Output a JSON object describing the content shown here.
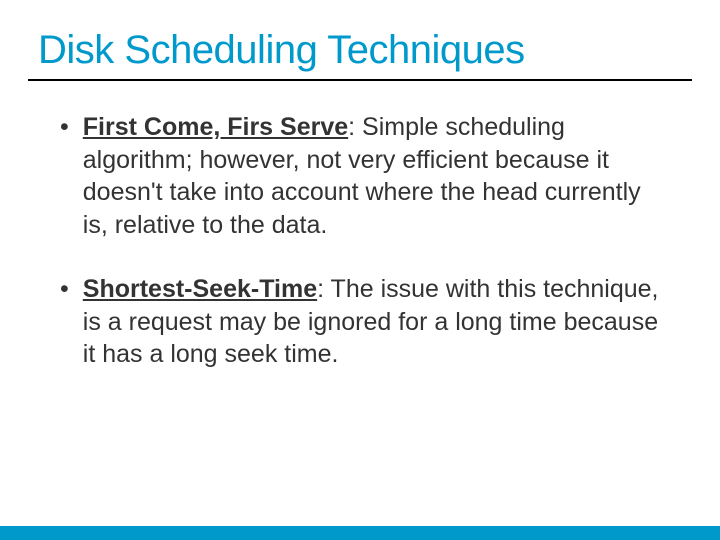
{
  "title": "Disk Scheduling Techniques",
  "bullets": [
    {
      "term": "First Come, Firs Serve",
      "definition": ": Simple scheduling algorithm; however, not very efficient because it doesn't take into account where the head currently is, relative to the data."
    },
    {
      "term": "Shortest-Seek-Time",
      "definition": ": The issue with this technique, is a request may be ignored for a long time because it has a long seek time."
    }
  ]
}
